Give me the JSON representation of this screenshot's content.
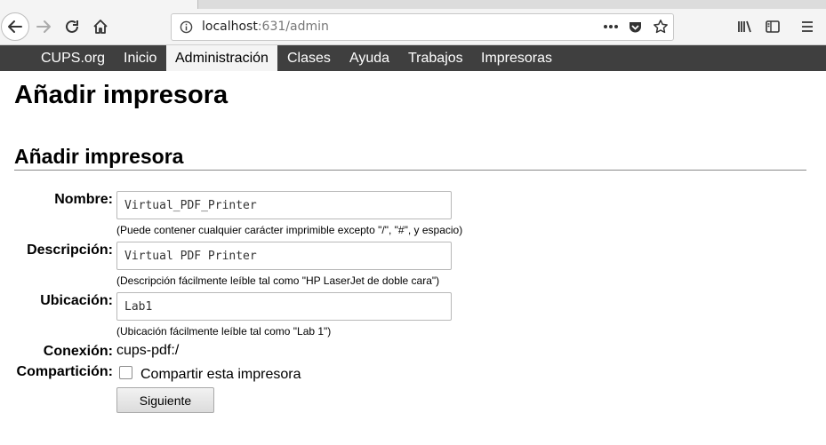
{
  "browser": {
    "url_host": "localhost",
    "url_path": ":631/admin",
    "icons": [
      "back-icon",
      "forward-icon",
      "reload-icon",
      "home-icon",
      "info-icon",
      "more-icon",
      "pocket-icon",
      "bookmark-star-icon",
      "library-icon",
      "sidebar-icon",
      "menu-icon"
    ]
  },
  "nav": {
    "items": [
      "CUPS.org",
      "Inicio",
      "Administración",
      "Clases",
      "Ayuda",
      "Trabajos",
      "Impresoras"
    ],
    "active": "Administración"
  },
  "page": {
    "title": "Añadir impresora",
    "section_title": "Añadir impresora"
  },
  "form": {
    "name_label": "Nombre:",
    "name_value": "Virtual_PDF_Printer",
    "name_hint": "(Puede contener cualquier carácter imprimible excepto \"/\", \"#\", y espacio)",
    "desc_label": "Descripción:",
    "desc_value": "Virtual PDF Printer",
    "desc_hint": "(Descripción fácilmente leíble tal como \"HP LaserJet de doble cara\")",
    "loc_label": "Ubicación:",
    "loc_value": "Lab1",
    "loc_hint": "(Ubicación fácilmente leíble tal como \"Lab 1\")",
    "conn_label": "Conexión:",
    "conn_value": "cups-pdf:/",
    "share_label": "Compartición:",
    "share_checkbox_label": "Compartir esta impresora",
    "share_checked": false,
    "submit_label": "Siguiente"
  }
}
